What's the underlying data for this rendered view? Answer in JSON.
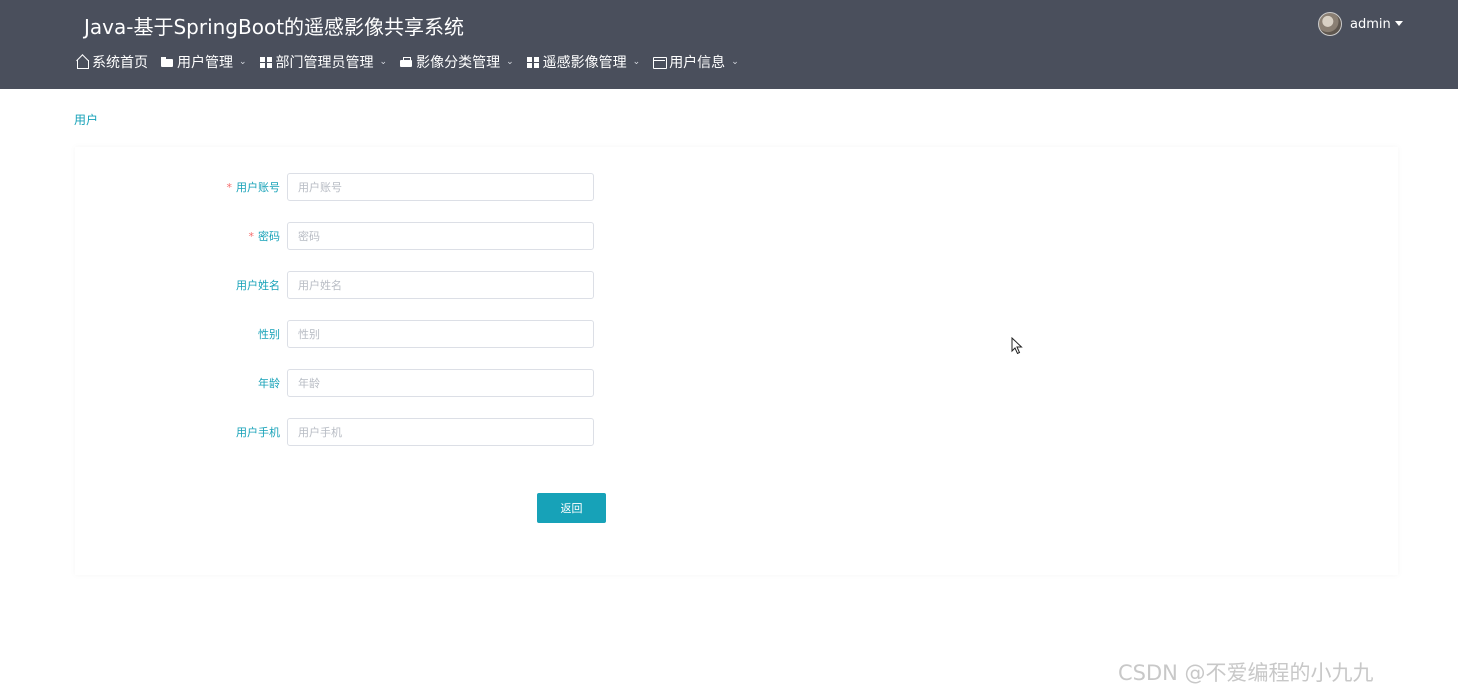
{
  "header": {
    "app_title": "Java-基于SpringBoot的遥感影像共享系统",
    "user_name": "admin"
  },
  "nav": {
    "items": [
      {
        "label": "系统首页",
        "icon": "home-icon",
        "has_dropdown": false
      },
      {
        "label": "用户管理",
        "icon": "folder-icon",
        "has_dropdown": true
      },
      {
        "label": "部门管理员管理",
        "icon": "grid-icon",
        "has_dropdown": true
      },
      {
        "label": "影像分类管理",
        "icon": "briefcase-icon",
        "has_dropdown": true
      },
      {
        "label": "遥感影像管理",
        "icon": "grid-icon",
        "has_dropdown": true
      },
      {
        "label": "用户信息",
        "icon": "card-icon",
        "has_dropdown": true
      }
    ]
  },
  "breadcrumb": {
    "current": "用户"
  },
  "form": {
    "fields": [
      {
        "label": "用户账号",
        "required": true,
        "placeholder": "用户账号",
        "value": ""
      },
      {
        "label": "密码",
        "required": true,
        "placeholder": "密码",
        "value": ""
      },
      {
        "label": "用户姓名",
        "required": false,
        "placeholder": "用户姓名",
        "value": ""
      },
      {
        "label": "性别",
        "required": false,
        "placeholder": "性别",
        "value": ""
      },
      {
        "label": "年龄",
        "required": false,
        "placeholder": "年龄",
        "value": ""
      },
      {
        "label": "用户手机",
        "required": false,
        "placeholder": "用户手机",
        "value": ""
      }
    ],
    "required_mark": "*",
    "back_label": "返回"
  },
  "watermark": "CSDN @不爱编程的小九九",
  "colors": {
    "header_bg": "#4a4f5c",
    "accent": "#17a2b8",
    "required": "#f56c6c"
  }
}
